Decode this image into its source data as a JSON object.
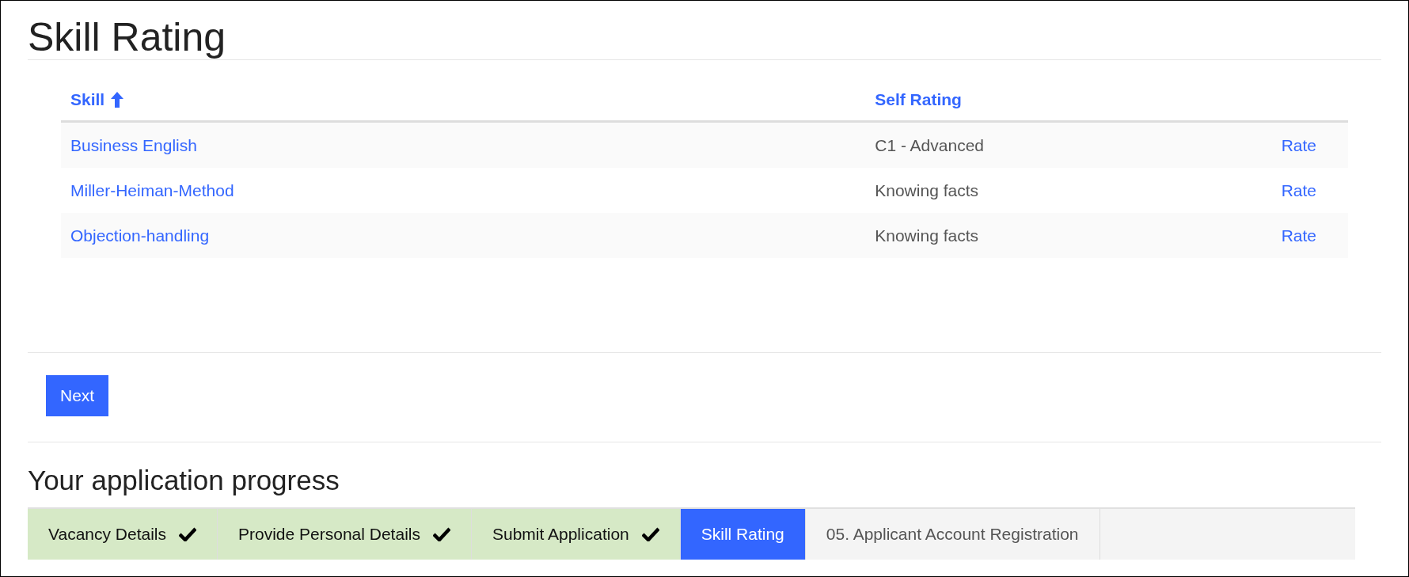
{
  "title": "Skill Rating",
  "table": {
    "columns": [
      {
        "label": "Skill",
        "sorted": true
      },
      {
        "label": "Self Rating",
        "sorted": false
      }
    ],
    "rows": [
      {
        "skill": "Business English",
        "rating": "C1 - Advanced",
        "action": "Rate"
      },
      {
        "skill": "Miller-Heiman-Method",
        "rating": "Knowing facts",
        "action": "Rate"
      },
      {
        "skill": "Objection-handling",
        "rating": "Knowing facts",
        "action": "Rate"
      }
    ]
  },
  "next_button": "Next",
  "progress": {
    "title": "Your application progress",
    "steps": [
      {
        "label": "Vacancy Details",
        "kind": "done",
        "selected": false
      },
      {
        "label": "Provide Personal Details",
        "kind": "done",
        "selected": false
      },
      {
        "label": "Submit Application",
        "kind": "done",
        "selected": false
      },
      {
        "label": "Skill Rating",
        "kind": "pending",
        "selected": true
      },
      {
        "label": "05. Applicant Account Registration",
        "kind": "pending",
        "selected": false
      }
    ]
  }
}
